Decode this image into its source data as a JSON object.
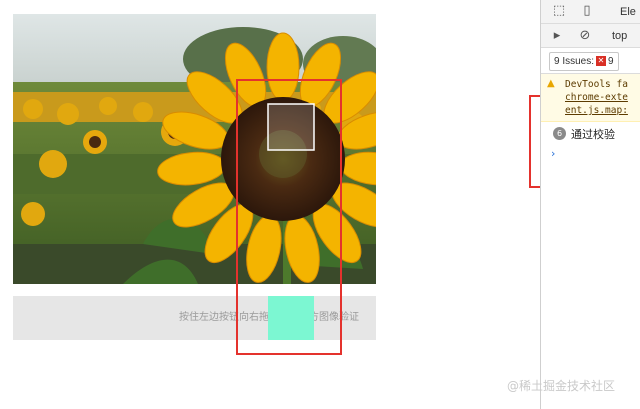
{
  "captcha": {
    "hint_text": "按住左边按钮向右拖动完成上方图像验证",
    "colors": {
      "thumb": "#7cf7d2",
      "track": "#e6e6e6",
      "highlight": "#e4322d"
    }
  },
  "devtools": {
    "toolbar": {
      "inspect_icon": "cursor-icon",
      "device_icon": "device-toggle-icon",
      "elements_tab": "Ele"
    },
    "console_toolbar": {
      "sidebar_icon": "sidebar-toggle-icon",
      "clear_icon": "clear-console-icon",
      "context": "top"
    },
    "issues": {
      "label": "9 Issues:",
      "count": "9"
    },
    "warning": {
      "text": "DevTools fa",
      "link_line1": "chrome-exte",
      "link_line2": "ent.js.map:"
    },
    "log": {
      "repeat_count": "6",
      "message": "通过校验"
    },
    "prompt": "›"
  },
  "watermark": "@稀土掘金技术社区"
}
